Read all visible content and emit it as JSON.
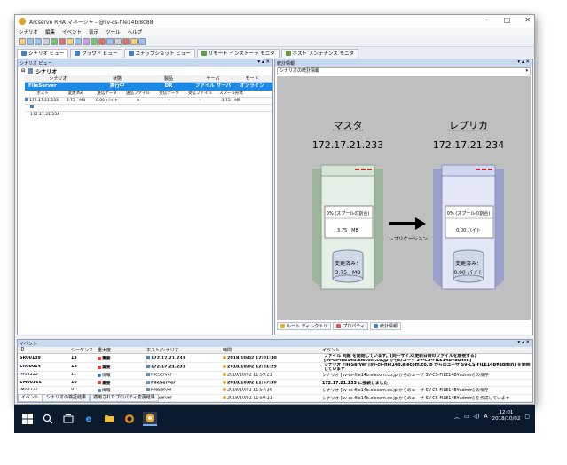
{
  "window": {
    "title": "Arcserve RHA マネージャ - @sv-cs-file14b:8088",
    "controls": {
      "minimize": "─",
      "maximize": "□",
      "close": "✕"
    }
  },
  "menu": [
    "シナリオ",
    "編集",
    "イベント",
    "表示",
    "ツール",
    "ヘルプ"
  ],
  "view_tabs": [
    {
      "label": "シナリオ ビュー",
      "active": true
    },
    {
      "label": "クラウド ビュー",
      "active": false
    },
    {
      "label": "スナップショット ビュー",
      "active": false
    },
    {
      "label": "リモート インストーラ モニタ",
      "active": false
    },
    {
      "label": "ホスト メンテナンス モニタ",
      "active": false
    }
  ],
  "scenario_panel": {
    "header": "シナリオ ビュー",
    "controls": "▾ ▴ ✕",
    "root_label": "シナリオ",
    "columns": [
      "シナリオ",
      "状態",
      "製品",
      "サーバ",
      "モード"
    ],
    "scenario": {
      "name": "FileServer",
      "state": "実行中",
      "product": "DR",
      "server": "ファイル サーバ",
      "mode": "オンライン"
    },
    "sub_columns": [
      "ホスト",
      "変更済み",
      "送信データ",
      "送信ファイル",
      "受信データ",
      "受信ファイル",
      "スプール形式"
    ],
    "rows": [
      {
        "host": "172.17.21.233",
        "changed": "3.75　MB",
        "sent_data": "0.00 バイト",
        "sent_files": "0",
        "recv_data": "-",
        "recv_files": "-",
        "spool": "3.75　MB"
      },
      {
        "host": "172.17.21.234",
        "changed": "",
        "sent_data": "",
        "sent_files": "",
        "recv_data": "",
        "recv_files": "",
        "spool": ""
      }
    ]
  },
  "stats_panel": {
    "header": "統計情報",
    "controls": "▾ ▴ ✕",
    "combo": "シナリオの統計情報",
    "master": {
      "role": "マスタ",
      "ip": "172.17.21.233",
      "spool": "0% (スプールの割合)",
      "spool_size": "3.75　MB",
      "changed_label": "変更済み：",
      "changed_value": "3.75　MB"
    },
    "replica": {
      "role": "レプリカ",
      "ip": "172.17.21.234",
      "spool": "0% (スプールの割合)",
      "spool_size": "0.00 バイト",
      "changed_label": "変更済み：",
      "changed_value": "0.00 バイト"
    },
    "arrow_label": "レプリケーション",
    "bottom_tabs": [
      {
        "label": "ルート ディレクトリ",
        "active": false,
        "color": "#e0b030"
      },
      {
        "label": "プロパティ",
        "active": false,
        "color": "#d06060"
      },
      {
        "label": "統計情報",
        "active": true,
        "color": "#4a7fc4"
      }
    ]
  },
  "events_panel": {
    "header": "イベント",
    "controls": "▾ ▴ ✕",
    "columns": [
      "ID",
      "シーケンス",
      "重大度",
      "ホスト/シナリオ",
      "時間",
      "イベント"
    ],
    "rows": [
      {
        "id": "SR00139",
        "seq": "13",
        "severity": "重要",
        "sev_color": "#e04040",
        "host": "172.17.21.233",
        "time": "2018/10/02 12:01:30",
        "event": "ファイル 同期 を開始しています。(同一サイズ/更新日時のファイルを無視する)",
        "event2": "[sv-cs-file14b.elecom.co.jp からのユーザ SV-CS-FILE14B¥admin]",
        "bold": true
      },
      {
        "id": "SR00014",
        "seq": "12",
        "severity": "重要",
        "sev_color": "#e04040",
        "host": "172.17.21.233",
        "time": "2018/10/02 12:01:29",
        "event": "シナリオ FileServer [sv-cs-file14b.elecom.co.jp からのユーザ SV-CS-FILE14B¥admin] を開始",
        "event2": "しています",
        "bold": true
      },
      {
        "id": "IM03122",
        "seq": "11",
        "severity": "情報",
        "sev_color": "#3a7fd0",
        "host": "FileServer",
        "time": "2018/10/02 11:59:21",
        "event": "シナリオ [sv-cs-file14b.elecom.co.jp からのユーザ SV-CS-FILE14B¥admin] の保存",
        "event2": "",
        "bold": false
      },
      {
        "id": "SM00165",
        "seq": "10",
        "severity": "重要",
        "sev_color": "#e04040",
        "host": "FileServer",
        "time": "2018/10/02 11:57:30",
        "event": "172.17.21.233 に接続しました",
        "event2": "",
        "bold": true
      },
      {
        "id": "IM03122",
        "seq": "9",
        "severity": "情報",
        "sev_color": "#3a7fd0",
        "host": "FileServer",
        "time": "2018/10/02 11:57:30",
        "event": "シナリオ [sv-cs-file14b.elecom.co.jp からのユーザ SV-CS-FILE14B¥admin] の保存",
        "event2": "",
        "bold": false
      },
      {
        "id": "IM03120",
        "seq": "8",
        "severity": "情報",
        "sev_color": "#3a7fd0",
        "host": "FileServer",
        "time": "2018/10/02 11:50:21",
        "event": "シナリオ [sv-cs-file14b.elecom.co.jp からのユーザ SV-CS-FILE14B¥admin] を作成しています",
        "event2": "",
        "bold": false
      }
    ],
    "bottom_tabs": [
      {
        "label": "イベント",
        "active": true
      },
      {
        "label": "シナリオの検証結果",
        "active": false
      },
      {
        "label": "適用されたプロパティ変更結果",
        "active": false
      }
    ]
  },
  "taskbar": {
    "ime": "A",
    "time": "12:01",
    "date": "2018/10/02"
  }
}
